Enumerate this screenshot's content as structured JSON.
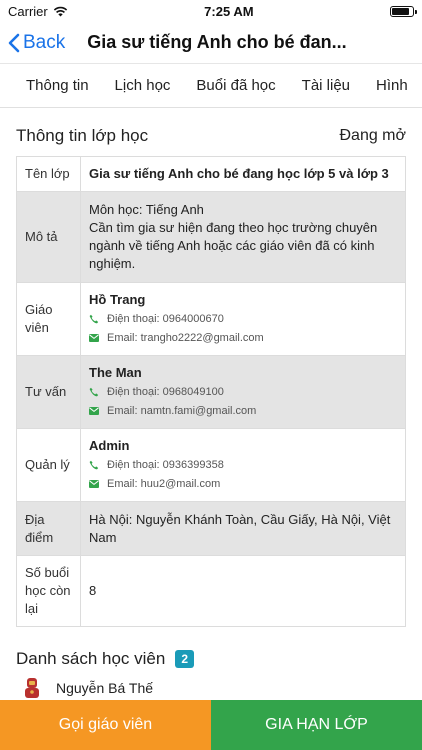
{
  "status_bar": {
    "carrier": "Carrier",
    "time": "7:25 AM"
  },
  "nav": {
    "back_label": "Back",
    "title": "Gia sư tiếng Anh cho bé đan..."
  },
  "tabs": [
    "Thông tin",
    "Lịch học",
    "Buổi đã học",
    "Tài liệu",
    "Hình"
  ],
  "class_info": {
    "heading": "Thông tin lớp học",
    "status": "Đang mở",
    "rows": {
      "name_label": "Tên lớp",
      "name_value": "Gia sư tiếng Anh cho bé đang học lớp 5 và lớp 3",
      "desc_label": "Mô tả",
      "desc_line1": "Môn học: Tiếng Anh",
      "desc_line2": "Cần tìm gia sư hiện đang theo học trường chuyên ngành về tiếng Anh hoặc các giáo viên đã có kinh nghiệm.",
      "teacher_label": "Giáo viên",
      "teacher_name": "Hồ Trang",
      "teacher_phone": "Điện thoại: 0964000670",
      "teacher_email": "Email: trangho2222@gmail.com",
      "consultant_label": "Tư vấn",
      "consultant_name": "The Man",
      "consultant_phone": "Điện thoại: 0968049100",
      "consultant_email": "Email: namtn.fami@gmail.com",
      "manager_label": "Quản lý",
      "manager_name": "Admin",
      "manager_phone": "Điện thoại: 0936399358",
      "manager_email": "Email: huu2@mail.com",
      "location_label": "Địa điểm",
      "location_value": "Hà Nội: Nguyễn Khánh Toàn, Cầu Giấy, Hà Nội, Việt Nam",
      "remaining_label": "Số buổi học còn lại",
      "remaining_value": "8"
    }
  },
  "students": {
    "heading": "Danh sách học viên",
    "count": "2",
    "items": [
      {
        "name": "Nguyễn Bá Thế"
      }
    ]
  },
  "actions": {
    "call_teacher": "Gọi giáo viên",
    "extend_class": "GIA HẠN LỚP"
  },
  "colors": {
    "accent": "#1a73e8",
    "icon_green": "#33a44b",
    "call_button": "#f59723",
    "extend_button": "#33a44b",
    "badge": "#1a9bb8"
  },
  "icons": [
    "wifi-icon",
    "battery-icon",
    "chevron-left-icon",
    "phone-icon",
    "email-icon",
    "student-avatar-icon"
  ]
}
